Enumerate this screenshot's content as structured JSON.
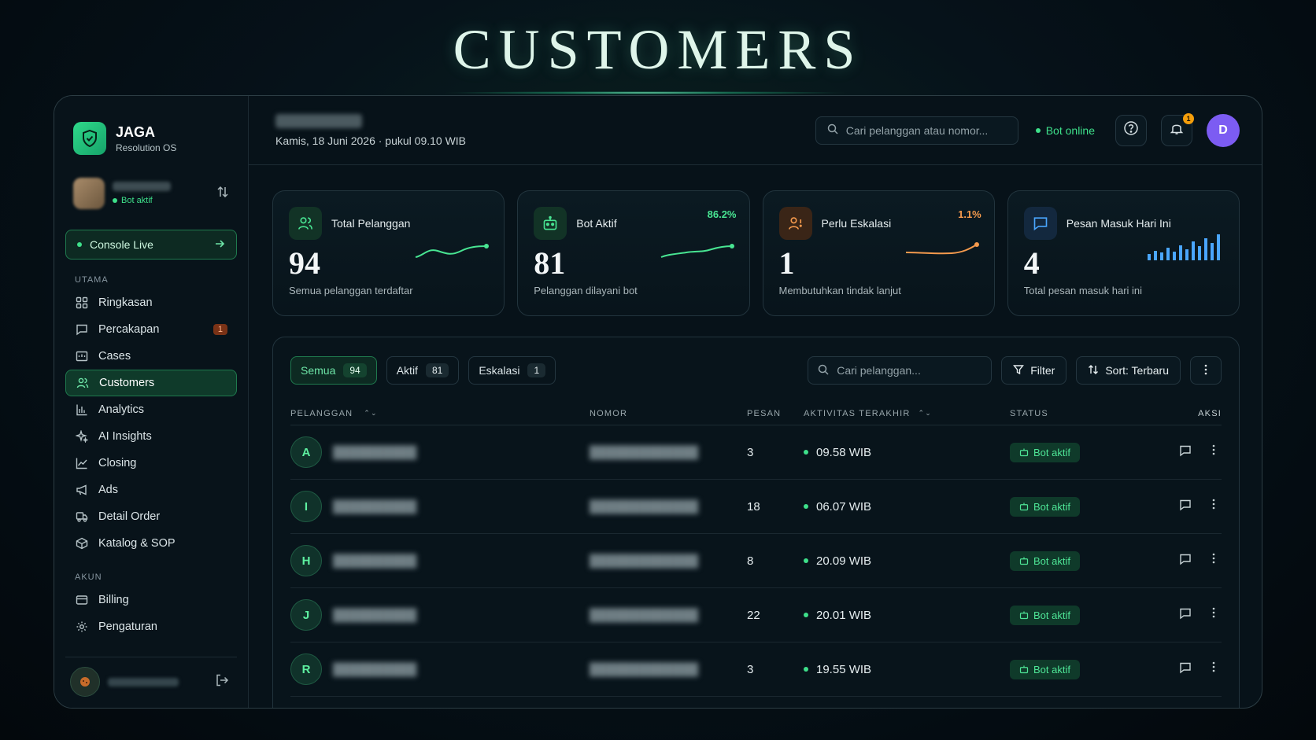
{
  "hero": {
    "title": "CUSTOMERS"
  },
  "brand": {
    "name": "JAGA",
    "subtitle": "Resolution OS"
  },
  "workspace": {
    "status": "Bot aktif"
  },
  "console": {
    "label": "Console Live"
  },
  "sidebar": {
    "section_main": "UTAMA",
    "items": [
      {
        "label": "Ringkasan",
        "icon": "grid-icon"
      },
      {
        "label": "Percakapan",
        "icon": "chat-icon",
        "badge": "1"
      },
      {
        "label": "Cases",
        "icon": "inbox-icon"
      },
      {
        "label": "Customers",
        "icon": "users-icon",
        "active": true
      },
      {
        "label": "Analytics",
        "icon": "bar-chart-icon"
      },
      {
        "label": "AI Insights",
        "icon": "sparkle-icon"
      },
      {
        "label": "Closing",
        "icon": "line-chart-icon"
      },
      {
        "label": "Ads",
        "icon": "megaphone-icon"
      },
      {
        "label": "Detail Order",
        "icon": "truck-icon"
      },
      {
        "label": "Katalog & SOP",
        "icon": "box-icon"
      }
    ],
    "section_account": "AKUN",
    "account_items": [
      {
        "label": "Billing",
        "icon": "card-icon"
      },
      {
        "label": "Pengaturan",
        "icon": "gear-icon"
      }
    ]
  },
  "topbar": {
    "date": "Kamis, 18 Juni 2026 · pukul 09.10 WIB",
    "search_placeholder": "Cari pelanggan atau nomor...",
    "bot_status": "Bot online",
    "notif_count": "1",
    "user_initial": "D"
  },
  "stats": [
    {
      "label": "Total Pelanggan",
      "value": "94",
      "desc": "Semua pelanggan terdaftar",
      "pct": "",
      "color": "#48e592"
    },
    {
      "label": "Bot Aktif",
      "value": "81",
      "desc": "Pelanggan dilayani bot",
      "pct": "86.2%",
      "color": "#48e592"
    },
    {
      "label": "Perlu Eskalasi",
      "value": "1",
      "desc": "Membutuhkan tindak lanjut",
      "pct": "1.1%",
      "color": "#f59a4d"
    },
    {
      "label": "Pesan Masuk Hari Ini",
      "value": "4",
      "desc": "Total pesan masuk hari ini",
      "pct": "",
      "color": "#4aa6ff"
    }
  ],
  "filters": {
    "tabs": [
      {
        "label": "Semua",
        "count": "94"
      },
      {
        "label": "Aktif",
        "count": "81"
      },
      {
        "label": "Eskalasi",
        "count": "1"
      }
    ],
    "search_placeholder": "Cari pelanggan...",
    "filter_label": "Filter",
    "sort_label": "Sort: Terbaru"
  },
  "table": {
    "columns": {
      "customer": "PELANGGAN",
      "number": "NOMOR",
      "messages": "PESAN",
      "activity": "AKTIVITAS TERAKHIR",
      "status": "STATUS",
      "actions": "AKSI"
    },
    "rows": [
      {
        "initial": "A",
        "messages": "3",
        "activity": "09.58 WIB",
        "status": "Bot aktif"
      },
      {
        "initial": "I",
        "messages": "18",
        "activity": "06.07 WIB",
        "status": "Bot aktif"
      },
      {
        "initial": "H",
        "messages": "8",
        "activity": "20.09 WIB",
        "status": "Bot aktif"
      },
      {
        "initial": "J",
        "messages": "22",
        "activity": "20.01 WIB",
        "status": "Bot aktif"
      },
      {
        "initial": "R",
        "messages": "3",
        "activity": "19.55 WIB",
        "status": "Bot aktif"
      }
    ]
  }
}
